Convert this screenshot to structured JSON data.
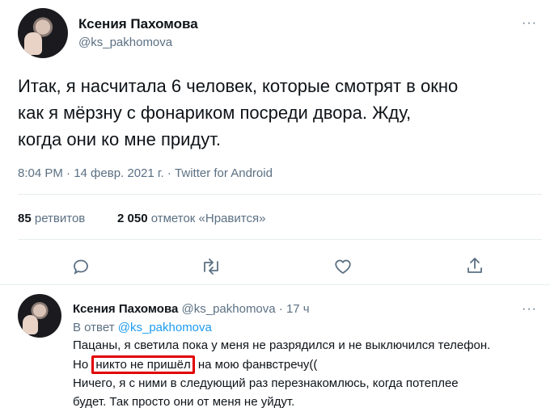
{
  "tweet": {
    "author_name": "Ксения Пахомова",
    "author_handle": "@ks_pakhomova",
    "more_glyph": "···",
    "text_line1": "Итак, я насчитала 6 человек, которые смотрят в окно",
    "text_line2": "как я мёрзну с фонариком посреди двора. Жду,",
    "text_line3": "когда они ко мне придут.",
    "meta": "8:04 PM · 14 февр. 2021 г. · Twitter for Android",
    "retweets_count": "85",
    "retweets_label": "ретвитов",
    "likes_count": "2 050",
    "likes_label": "отметок «Нравится»"
  },
  "reply": {
    "author_name": "Ксения Пахомова",
    "author_handle": "@ks_pakhomova",
    "time": "· 17 ч",
    "more_glyph": "···",
    "reply_prefix": "В ответ",
    "reply_to": "@ks_pakhomova",
    "line1": "Пацаны, я светила пока у меня не разрядился и не выключился телефон.",
    "line2_start": "Но ",
    "line2_highlight": "никто не пришёл",
    "line2_end": " на мою фанвстречу((",
    "line3": "Ничего, я с ними в следующий раз перезнакомлюсь, когда потеплее",
    "line4": "будет. Так просто они от меня не уйдут."
  },
  "icons": {
    "reply": "comment-icon",
    "retweet": "retweet-icon",
    "like": "heart-icon",
    "share": "share-icon"
  },
  "colors": {
    "link": "#1d9bf0",
    "highlight_box": "#e10000"
  }
}
